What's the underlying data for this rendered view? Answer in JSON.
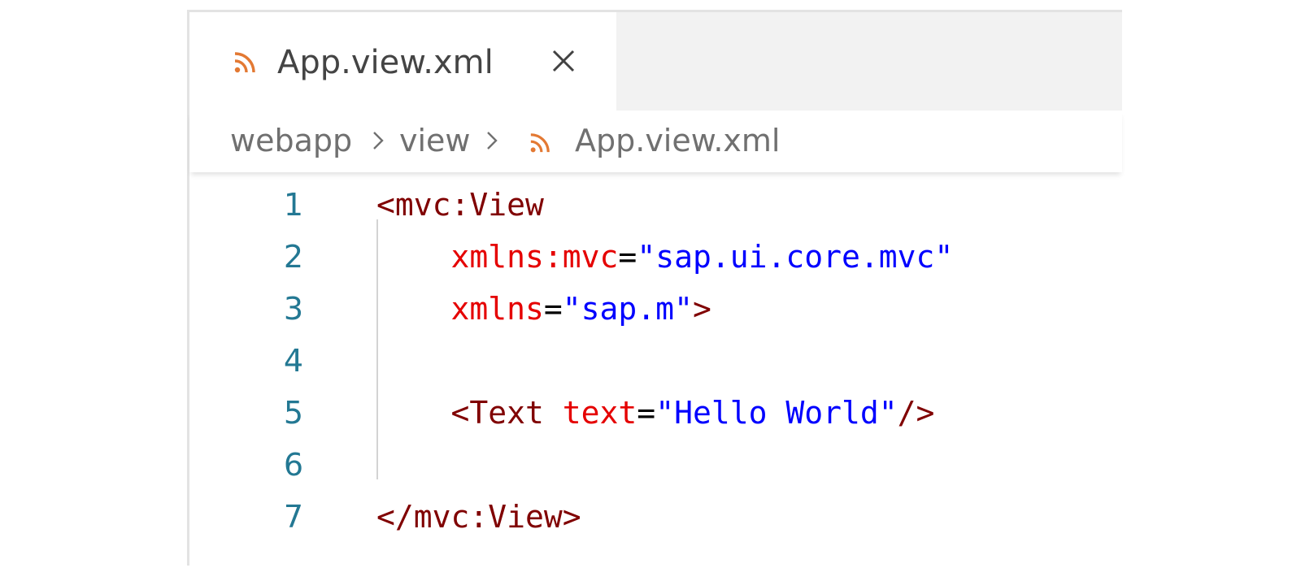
{
  "tab": {
    "icon": "xml-rss-icon",
    "label": "App.view.xml",
    "close_icon": "close-icon"
  },
  "breadcrumb": {
    "items": [
      "webapp",
      "view",
      "App.view.xml"
    ],
    "separator_icon": "chevron-right-icon",
    "file_icon": "xml-rss-icon"
  },
  "editor": {
    "lines": [
      {
        "number": "1",
        "tokens": [
          {
            "t": "tag",
            "v": "<mvc:View"
          }
        ]
      },
      {
        "number": "2",
        "tokens": [
          {
            "t": "attr",
            "v": "    xmlns:mvc"
          },
          {
            "t": "eq",
            "v": "="
          },
          {
            "t": "str",
            "v": "\"sap.ui.core.mvc\""
          }
        ]
      },
      {
        "number": "3",
        "tokens": [
          {
            "t": "attr",
            "v": "    xmlns"
          },
          {
            "t": "eq",
            "v": "="
          },
          {
            "t": "str",
            "v": "\"sap.m\""
          },
          {
            "t": "tag",
            "v": ">"
          }
        ]
      },
      {
        "number": "4",
        "tokens": []
      },
      {
        "number": "5",
        "tokens": [
          {
            "t": "tag",
            "v": "    <Text "
          },
          {
            "t": "attr",
            "v": "text"
          },
          {
            "t": "eq",
            "v": "="
          },
          {
            "t": "str",
            "v": "\"Hello World\""
          },
          {
            "t": "tag",
            "v": "/>"
          }
        ]
      },
      {
        "number": "6",
        "tokens": []
      },
      {
        "number": "7",
        "tokens": [
          {
            "t": "tag",
            "v": "</mvc:View>"
          }
        ]
      }
    ]
  },
  "colors": {
    "tag": "#800000",
    "attribute": "#e50000",
    "string": "#0000ff",
    "line_number": "#237893",
    "icon_orange": "#e37933"
  }
}
